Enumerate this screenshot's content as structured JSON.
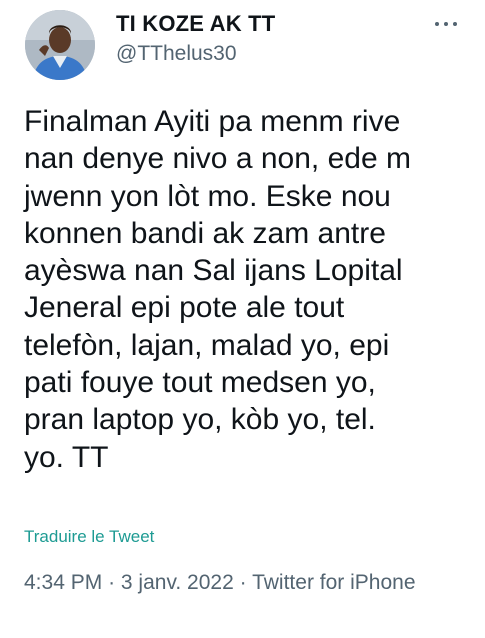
{
  "author": {
    "display_name": "TI KOZE AK TT",
    "handle": "@TThelus30",
    "avatar_icon": "profile-photo"
  },
  "menu": {
    "more_icon": "more-horizontal-icon"
  },
  "tweet": {
    "lines": [
      "Finalman Ayiti pa menm rive",
      "nan denye nivo a non, ede m",
      "jwenn yon lòt mo. Eske nou",
      "konnen bandi ak zam antre",
      "ayèswa nan Sal ijans Lopital",
      "Jeneral epi pote ale tout",
      "telefòn, lajan, malad yo, epi",
      "pati fouye tout medsen yo,",
      "pran laptop yo, kòb yo, tel.",
      "yo. TT"
    ],
    "translate_label": "Traduire le Tweet",
    "time": "4:34 PM",
    "separator": "·",
    "date": "3 janv. 2022",
    "source": "Twitter for iPhone"
  },
  "colors": {
    "text": "#0f1419",
    "secondary": "#536471",
    "link": "#1d9b93"
  }
}
